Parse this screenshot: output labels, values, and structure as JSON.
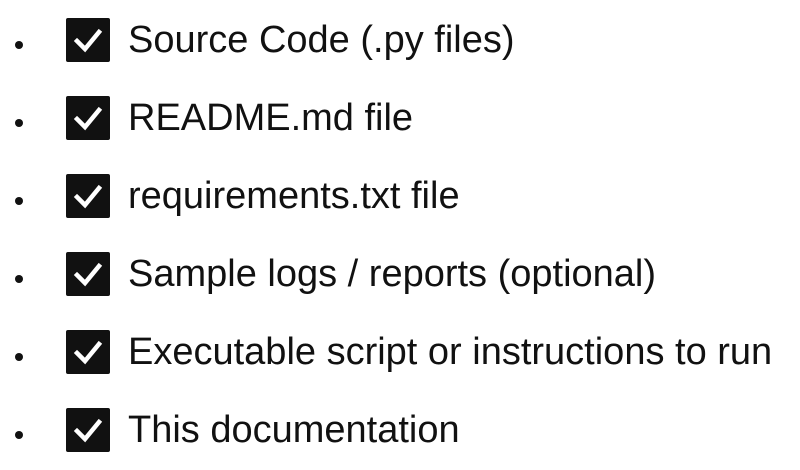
{
  "checklist": {
    "items": [
      {
        "label": "Source Code (.py files)",
        "checked": true,
        "icon": "checkbox-checked-icon"
      },
      {
        "label": "README.md file",
        "checked": true,
        "icon": "checkbox-checked-icon"
      },
      {
        "label": "requirements.txt file",
        "checked": true,
        "icon": "checkbox-checked-icon"
      },
      {
        "label": "Sample logs / reports (optional)",
        "checked": true,
        "icon": "checkbox-checked-icon"
      },
      {
        "label": "Executable script or instructions to run",
        "checked": true,
        "icon": "checkbox-checked-icon"
      },
      {
        "label": "This documentation",
        "checked": true,
        "icon": "checkbox-checked-icon"
      }
    ]
  },
  "colors": {
    "text": "#111111",
    "checkbox_fill": "#111111",
    "checkmark": "#ffffff",
    "background": "#ffffff"
  }
}
